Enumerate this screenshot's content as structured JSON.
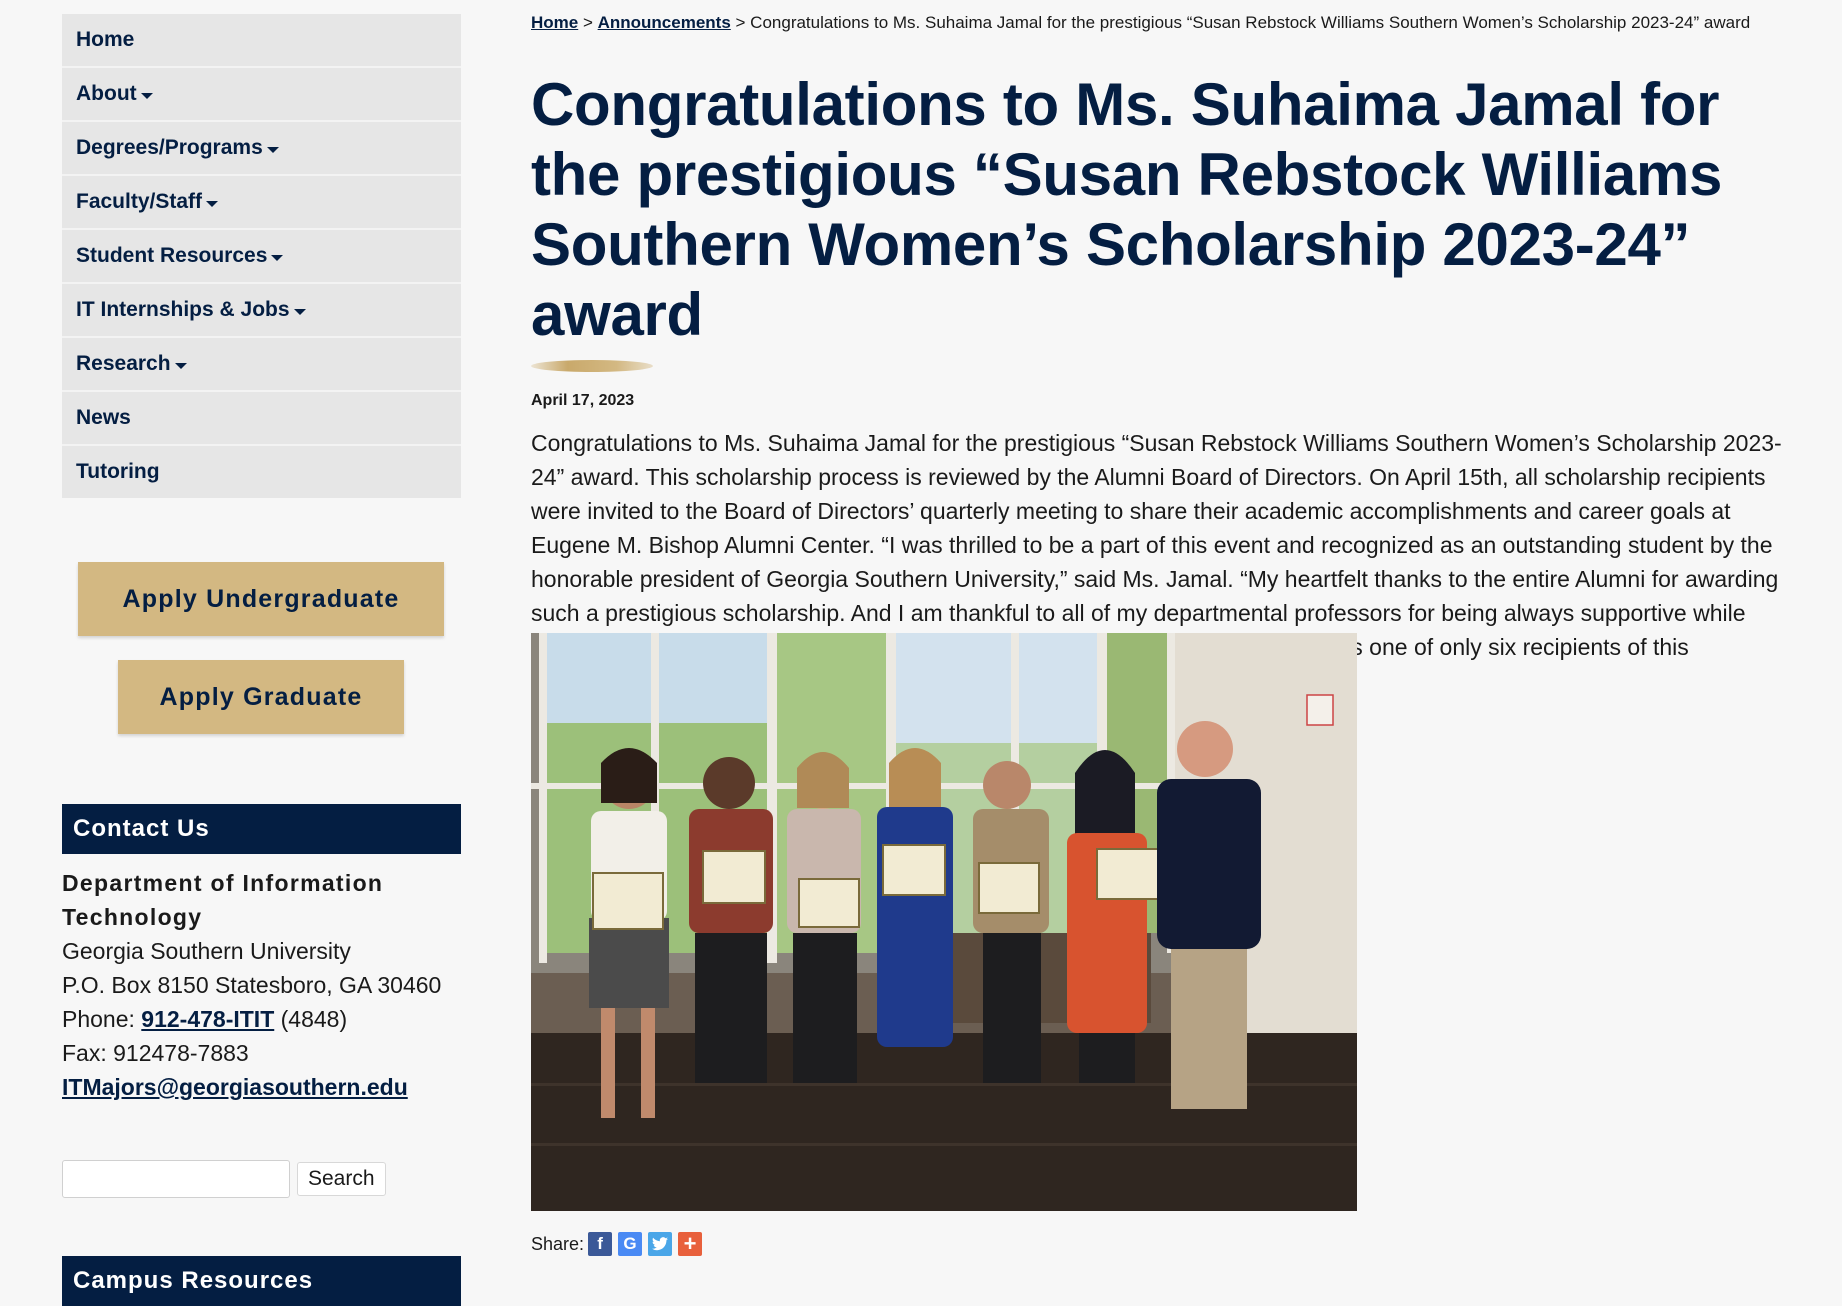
{
  "sidebar": {
    "nav": [
      {
        "label": "Home",
        "dropdown": false
      },
      {
        "label": "About",
        "dropdown": true
      },
      {
        "label": "Degrees/Programs",
        "dropdown": true
      },
      {
        "label": "Faculty/Staff",
        "dropdown": true
      },
      {
        "label": "Student Resources",
        "dropdown": true
      },
      {
        "label": "IT Internships & Jobs",
        "dropdown": true
      },
      {
        "label": "Research",
        "dropdown": true
      },
      {
        "label": "News",
        "dropdown": false
      },
      {
        "label": "Tutoring",
        "dropdown": false
      }
    ],
    "apply_undergraduate": "Apply Undergraduate",
    "apply_graduate": "Apply Graduate",
    "contact": {
      "heading": "Contact Us",
      "department": "Department of Information Technology",
      "university": "Georgia Southern University",
      "address": "P.O. Box 8150 Statesboro, GA 30460",
      "phone_prefix": "Phone: ",
      "phone_link": "912-478-ITIT",
      "phone_suffix": " (4848)",
      "fax": "Fax: 912478-7883",
      "email": "ITMajors@georgiasouthern.edu"
    },
    "search": {
      "placeholder": "",
      "button": "Search"
    },
    "campus_heading": "Campus Resources"
  },
  "main": {
    "breadcrumb": {
      "home": "Home",
      "sep": " > ",
      "announcements": "Announcements",
      "current": "Congratulations to Ms. Suhaima Jamal for the prestigious “Susan Rebstock Williams Southern Women’s Scholarship 2023-24” award"
    },
    "title": "Congratulations to Ms. Suhaima Jamal for the prestigious “Susan Rebstock Williams Southern Women’s Scholarship 2023-24” award",
    "date": "April 17, 2023",
    "body": "Congratulations to Ms. Suhaima Jamal for the prestigious “Susan Rebstock Williams Southern Women’s Scholarship 2023-24” award. This scholarship process is reviewed by the Alumni Board of Directors. On April 15th, all scholarship recipients were invited to the Board of Directors’ quarterly meeting to share their academic accomplishments and career goals at Eugene M. Bishop Alumni Center. “I was thrilled to be a part of this event and recognized as an outstanding student by the honorable president of Georgia Southern University,” said Ms. Jamal. “My heartfelt thanks to the entire Alumni for awarding such a prestigious scholarship. And I am thankful to all of my departmental professors for being always supportive while guiding and supervising me along the journey of this MSIT program.” Ms. Jamal is one of only six recipients of this scholarship at the university. We are all proud of her achievement.",
    "share_label": "Share:",
    "share_icons": [
      "facebook-icon",
      "google-icon",
      "twitter-icon",
      "plus-icon"
    ]
  },
  "colors": {
    "navy": "#041e42",
    "gold": "#d3b882",
    "nav_bg": "#e6e6e6"
  }
}
